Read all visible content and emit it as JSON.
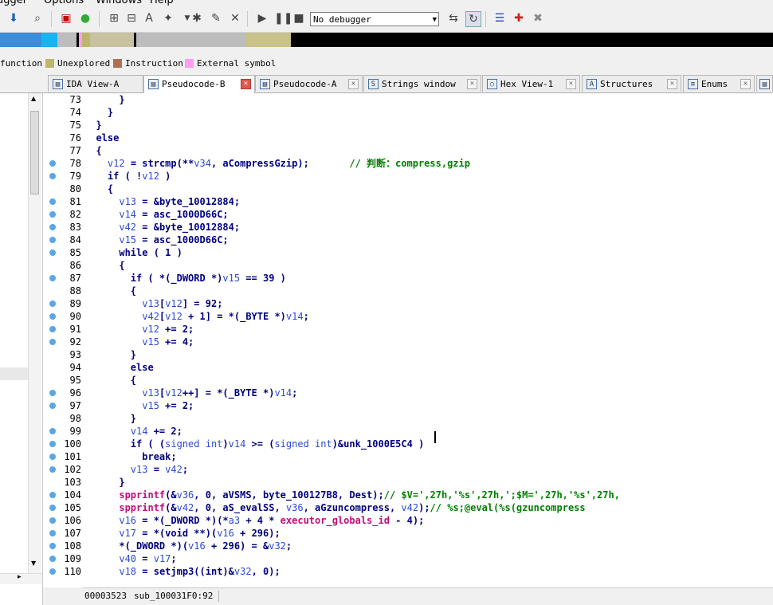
{
  "menu": {
    "items": [
      "ugger",
      "Options",
      "Windows",
      "Help"
    ]
  },
  "toolbar": {
    "debugger_select": "No debugger"
  },
  "legend": [
    {
      "label": "function",
      "color": ""
    },
    {
      "label": "Unexplored",
      "color": "#bdb76b"
    },
    {
      "label": "Instruction",
      "color": "#b07050"
    },
    {
      "label": "External symbol",
      "color": "#ff9cf3"
    }
  ],
  "tabs": [
    {
      "label": "IDA View-A",
      "active": false
    },
    {
      "label": "Pseudocode-B",
      "active": true
    },
    {
      "label": "Pseudocode-A",
      "active": false
    },
    {
      "label": "Strings window",
      "active": false
    },
    {
      "label": "Hex View-1",
      "active": false
    },
    {
      "label": "Structures",
      "active": false
    },
    {
      "label": "Enums",
      "active": false
    }
  ],
  "code_lines": [
    {
      "n": "73",
      "bp": false,
      "t": "      }"
    },
    {
      "n": "74",
      "bp": false,
      "t": "    }"
    },
    {
      "n": "75",
      "bp": false,
      "t": "  }"
    },
    {
      "n": "76",
      "bp": false,
      "t": "  else"
    },
    {
      "n": "77",
      "bp": false,
      "t": "  {"
    },
    {
      "n": "78",
      "bp": true,
      "t": "    v12 = strcmp(**v34, aCompressGzip);       // 判断：compress,gzip"
    },
    {
      "n": "79",
      "bp": true,
      "t": "    if ( !v12 )"
    },
    {
      "n": "80",
      "bp": false,
      "t": "    {"
    },
    {
      "n": "81",
      "bp": true,
      "t": "      v13 = &byte_10012884;"
    },
    {
      "n": "82",
      "bp": true,
      "t": "      v14 = asc_1000D66C;"
    },
    {
      "n": "83",
      "bp": true,
      "t": "      v42 = &byte_10012884;"
    },
    {
      "n": "84",
      "bp": true,
      "t": "      v15 = asc_1000D66C;"
    },
    {
      "n": "85",
      "bp": true,
      "t": "      while ( 1 )"
    },
    {
      "n": "86",
      "bp": false,
      "t": "      {"
    },
    {
      "n": "87",
      "bp": true,
      "t": "        if ( *(_DWORD *)v15 == 39 )"
    },
    {
      "n": "88",
      "bp": false,
      "t": "        {"
    },
    {
      "n": "89",
      "bp": true,
      "t": "          v13[v12] = 92;"
    },
    {
      "n": "90",
      "bp": true,
      "t": "          v42[v12 + 1] = *(_BYTE *)v14;"
    },
    {
      "n": "91",
      "bp": true,
      "t": "          v12 += 2;"
    },
    {
      "n": "92",
      "bp": true,
      "t": "          v15 += 4;"
    },
    {
      "n": "93",
      "bp": false,
      "t": "        }"
    },
    {
      "n": "94",
      "bp": false,
      "t": "        else"
    },
    {
      "n": "95",
      "bp": false,
      "t": "        {"
    },
    {
      "n": "96",
      "bp": true,
      "t": "          v13[v12++] = *(_BYTE *)v14;"
    },
    {
      "n": "97",
      "bp": true,
      "t": "          v15 += 2;"
    },
    {
      "n": "98",
      "bp": false,
      "t": "        }"
    },
    {
      "n": "99",
      "bp": true,
      "t": "        v14 += 2;"
    },
    {
      "n": "100",
      "bp": true,
      "t": "        if ( (signed int)v14 >= (signed int)&unk_1000E5C4 )"
    },
    {
      "n": "101",
      "bp": true,
      "t": "          break;"
    },
    {
      "n": "102",
      "bp": true,
      "t": "        v13 = v42;"
    },
    {
      "n": "103",
      "bp": false,
      "t": "      }"
    },
    {
      "n": "104",
      "bp": true,
      "t": "      spprintf(&v36, 0, aVSMS, byte_100127B8, Dest);// $V=',27h,'%s',27h,';$M=',27h,'%s',27h,"
    },
    {
      "n": "105",
      "bp": true,
      "t": "      spprintf(&v42, 0, aS_evalSS, v36, aGzuncompress, v42);// %s;@eval(%s(gzuncompress"
    },
    {
      "n": "106",
      "bp": true,
      "t": "      v16 = *(_DWORD *)(*a3 + 4 * executor_globals_id - 4);"
    },
    {
      "n": "107",
      "bp": true,
      "t": "      v17 = *(void **)(v16 + 296);"
    },
    {
      "n": "108",
      "bp": true,
      "t": "      *(_DWORD *)(v16 + 296) = &v32;"
    },
    {
      "n": "109",
      "bp": true,
      "t": "      v40 = v17;"
    },
    {
      "n": "110",
      "bp": true,
      "t": "      v18 = setjmp3((int)&v32, 0);"
    }
  ],
  "status": {
    "address": "00003523",
    "location": "sub_100031F0:92"
  },
  "colors": {
    "breakpoint": "#5aa6e6",
    "keyword": "#000080",
    "variable": "#2b4ad3",
    "comment": "#008000",
    "function": "#c40b7b"
  }
}
